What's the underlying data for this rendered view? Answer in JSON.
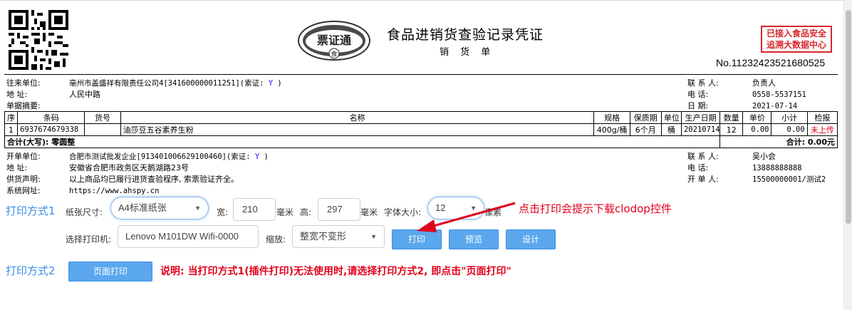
{
  "header": {
    "title": "食品进销货查验记录凭证",
    "subtitle": "销 货 单",
    "logo_text": "票证通",
    "logo_sub": "食",
    "stamp_line1": "已接入食品安全",
    "stamp_line2": "追溯大数据中心",
    "doc_no": "No.11232423521680525"
  },
  "party": {
    "partner_label": "往来单位:",
    "partner_value": "亳州市盖盛祥有限责任公司4[341600000011251](索证: ",
    "partner_flag": "Y",
    "partner_close": " )",
    "address_label": "地    址:",
    "address_value": "人民中路",
    "memo_label": "单据摘要:",
    "contact_label": "联 系 人:",
    "contact_value": "负责人",
    "phone_label": "电    话:",
    "phone_value": "0558-5537151",
    "date_label": "日    期:",
    "date_value": "2021-07-14"
  },
  "table": {
    "headers": [
      "序",
      "条码",
      "货号",
      "名称",
      "规格",
      "保质期",
      "单位",
      "生产日期",
      "数量",
      "单价",
      "小计",
      "检报"
    ],
    "rows": [
      [
        "1",
        "6937674679338",
        "",
        "油莎豆五谷素养生粉",
        "400g/桶",
        "6个月",
        "桶",
        "20210714",
        "12",
        "0.00",
        "0.00",
        "未上传"
      ]
    ],
    "total_left": "合计(大写): 零圆整",
    "total_right": "合计: 0.00元"
  },
  "issuer": {
    "unit_label": "开单单位:",
    "unit_value": "合肥市测试批发企业[913401006629100460](索证: ",
    "unit_flag": "Y",
    "unit_close": " )",
    "address_label": "地    址:",
    "address_value": "安徽省合肥市政务区天鹅湖路23号",
    "statement_label": "供货声明:",
    "statement_value": "以上商品均已履行进货查验程序, 索票验证齐全。",
    "site_label": "系统网址:",
    "site_value": "https://www.ahspy.cn",
    "contact_label": "联 系 人:",
    "contact_value": "吴小会",
    "phone_label": "电    话:",
    "phone_value": "13888888888",
    "operator_label": "开 单 人:",
    "operator_value": "15500000001/测试2"
  },
  "print1": {
    "title": "打印方式1",
    "paper_label": "纸张尺寸:",
    "paper_value": "A4标准纸张",
    "width_label": "宽:",
    "width_value": "210",
    "unit_mm": "毫米",
    "height_label": "高:",
    "height_value": "297",
    "font_label": "字体大小:",
    "font_value": "12",
    "font_unit": "像素",
    "printer_label": "选择打印机:",
    "printer_value": "Lenovo M101DW Wifi-0000",
    "zoom_label": "缩放:",
    "zoom_value": "整宽不变形",
    "print_btn": "打印",
    "preview_btn": "预览",
    "design_btn": "设计",
    "hint": "点击打印会提示下载clodop控件"
  },
  "print2": {
    "title": "打印方式2",
    "page_print_btn": "页面打印",
    "note": "说明: 当打印方式1(插件打印)无法使用时,请选择打印方式2, 即点击\"页面打印\""
  },
  "colors": {
    "accent": "#3a8ee6",
    "button": "#5aa7ee",
    "warning": "#e0001b"
  },
  "icons": [
    "qr-code-icon",
    "logo-icon",
    "dropdown-arrow-icon",
    "red-arrow-icon"
  ]
}
